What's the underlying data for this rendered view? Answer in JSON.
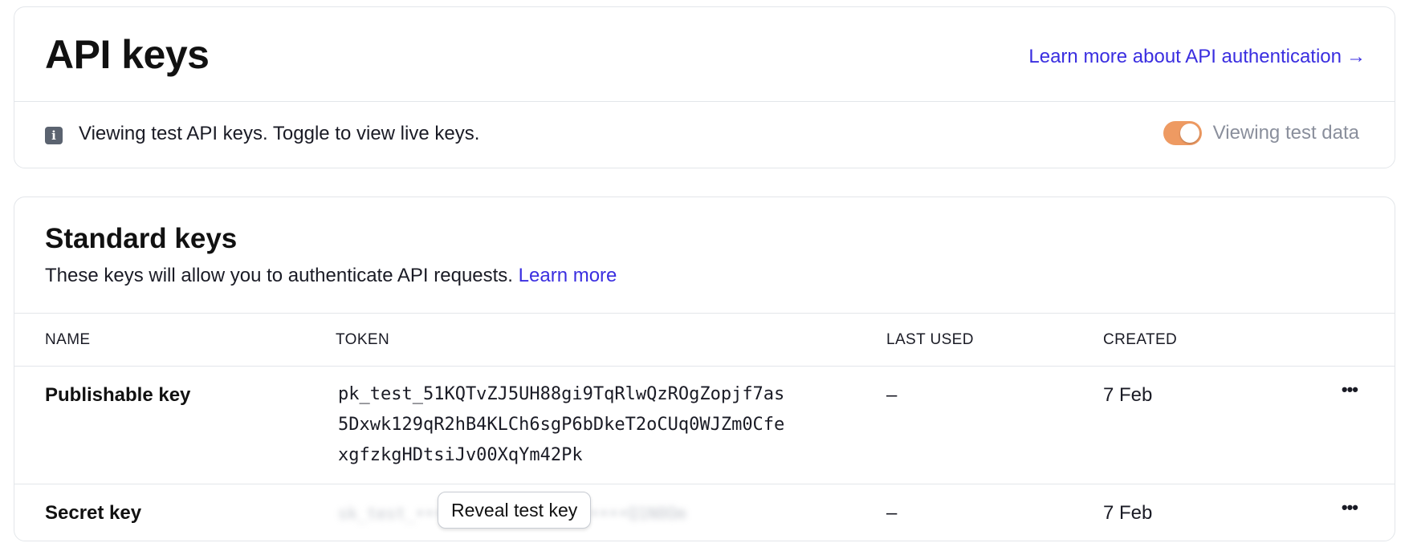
{
  "header": {
    "title": "API keys",
    "learn_link": "Learn more about API authentication",
    "learn_arrow": "→"
  },
  "notice": {
    "text": "Viewing test API keys. Toggle to view live keys.",
    "toggle_label": "Viewing test data",
    "toggle_on": true,
    "toggle_color": "#ee9a62"
  },
  "standard_keys": {
    "title": "Standard keys",
    "description": "These keys will allow you to authenticate API requests.",
    "learn_more": "Learn more",
    "columns": [
      "NAME",
      "TOKEN",
      "LAST USED",
      "CREATED"
    ],
    "rows": [
      {
        "name": "Publishable key",
        "token": "pk_test_51KQTvZJ5UH88gi9TqRlwQzROgZopjf7as5Dxwk129qR2hB4KLCh6sgP6bDkeT2oCUq0WJZm0Cfexgfzkg HDtsiJv00XqYm42Pk",
        "token_lines": [
          "pk_test_51KQTvZJ5UH88gi9TqRlwQzROgZopjf7as",
          "5Dxwk129qR2hB4KLCh6sgP6bDkeT2oCUq0WJZm0Cfe",
          "xgfzkgHDtsiJv00XqYm42Pk"
        ],
        "last_used": "–",
        "created": "7 Feb"
      },
      {
        "name": "Secret key",
        "reveal_button": "Reveal test key",
        "last_used": "–",
        "created": "7 Feb"
      }
    ]
  },
  "colors": {
    "link": "#3a2ee0",
    "border": "#e3e6ea"
  }
}
